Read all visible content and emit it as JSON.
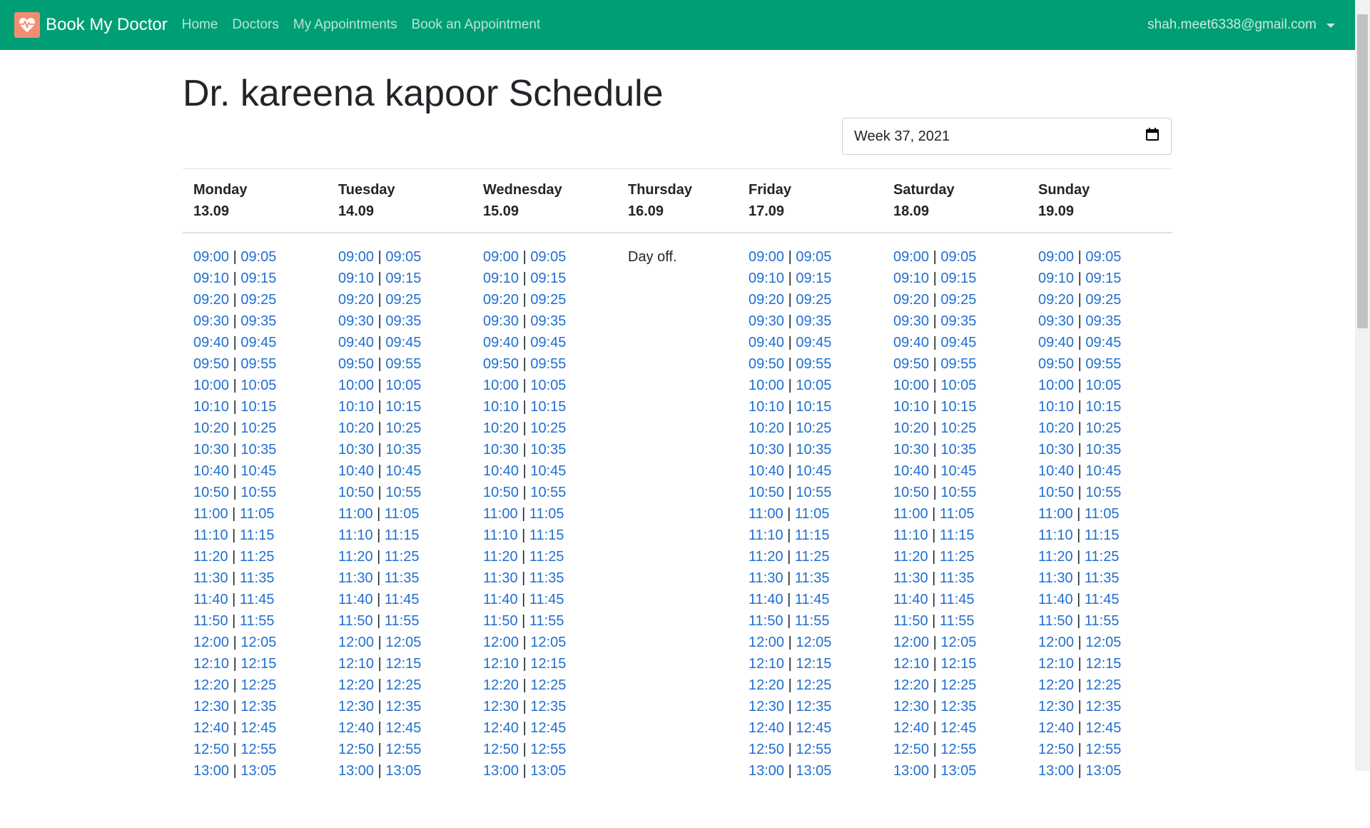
{
  "brand": {
    "name": "Book My Doctor",
    "logo_icon": "heart-pulse-icon"
  },
  "nav": {
    "items": [
      "Home",
      "Doctors",
      "My Appointments",
      "Book an Appointment"
    ]
  },
  "user": {
    "email": "shah.meet6338@gmail.com"
  },
  "page": {
    "title": "Dr. kareena kapoor Schedule"
  },
  "week_picker": {
    "value": "Week 37, 2021",
    "icon": "calendar-icon"
  },
  "colors": {
    "navbar": "#009e74",
    "link": "#1f6fd0",
    "logo": "#f28c74"
  },
  "day_off_text": "Day off.",
  "days": [
    {
      "name": "Monday",
      "date": "13.09",
      "day_off": false
    },
    {
      "name": "Tuesday",
      "date": "14.09",
      "day_off": false
    },
    {
      "name": "Wednesday",
      "date": "15.09",
      "day_off": false
    },
    {
      "name": "Thursday",
      "date": "16.09",
      "day_off": true
    },
    {
      "name": "Friday",
      "date": "17.09",
      "day_off": false
    },
    {
      "name": "Saturday",
      "date": "18.09",
      "day_off": false
    },
    {
      "name": "Sunday",
      "date": "19.09",
      "day_off": false
    }
  ],
  "slot_pairs": [
    [
      "09:00",
      "09:05"
    ],
    [
      "09:10",
      "09:15"
    ],
    [
      "09:20",
      "09:25"
    ],
    [
      "09:30",
      "09:35"
    ],
    [
      "09:40",
      "09:45"
    ],
    [
      "09:50",
      "09:55"
    ],
    [
      "10:00",
      "10:05"
    ],
    [
      "10:10",
      "10:15"
    ],
    [
      "10:20",
      "10:25"
    ],
    [
      "10:30",
      "10:35"
    ],
    [
      "10:40",
      "10:45"
    ],
    [
      "10:50",
      "10:55"
    ],
    [
      "11:00",
      "11:05"
    ],
    [
      "11:10",
      "11:15"
    ],
    [
      "11:20",
      "11:25"
    ],
    [
      "11:30",
      "11:35"
    ],
    [
      "11:40",
      "11:45"
    ],
    [
      "11:50",
      "11:55"
    ],
    [
      "12:00",
      "12:05"
    ],
    [
      "12:10",
      "12:15"
    ],
    [
      "12:20",
      "12:25"
    ],
    [
      "12:30",
      "12:35"
    ],
    [
      "12:40",
      "12:45"
    ],
    [
      "12:50",
      "12:55"
    ],
    [
      "13:00",
      "13:05"
    ]
  ]
}
